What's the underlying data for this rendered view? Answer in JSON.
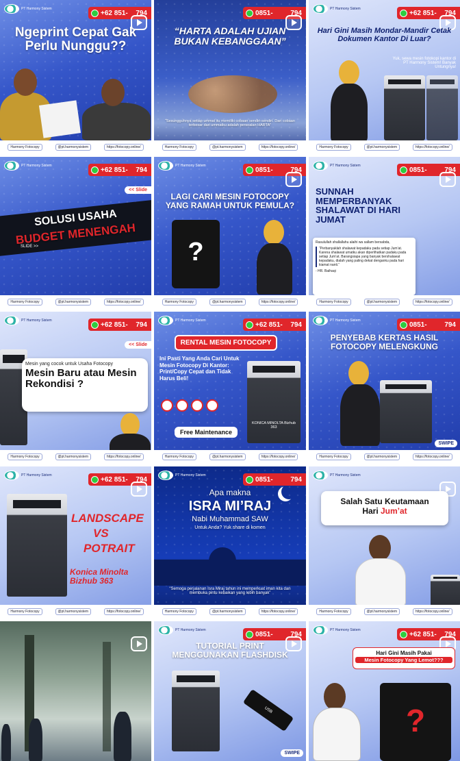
{
  "phone_full": "+62 851-",
  "phone_alt": "0851-",
  "phone_tail": "794",
  "logo_text": "PT Harmony Sistem",
  "footer": {
    "fb": "Harmony Fotocopy",
    "ig": "@pt.harmonysistem",
    "web": "https://fotocopy.online/"
  },
  "tiles": [
    {
      "title": "Ngeprint Cepat Gak Perlu Nunggu??"
    },
    {
      "title": "“HARTA ADALAH UJIAN BUKAN KEBANGGAAN”",
      "quote": "“Sesungguhnya setiap ummat itu memiliki cobaan sendiri-sendiri. Dan cobaan terbesar dari ummatku adalah persoalan HARTA”"
    },
    {
      "title": "Hari Gini Masih Mondar-Mandir Cetak Dokumen Kantor Di Luar?",
      "sub": "Yuk, sewa mesin fotokopi kantor di PT Harmony Sistem! Banyak Untungnya!"
    },
    {
      "title1": "SOLUSI USAHA",
      "title2": "BUDGET MENENGAH",
      "tag": "<< Slide",
      "slide": "SLIDE >>"
    },
    {
      "title": "LAGI CARI MESIN FOTOCOPY YANG RAMAH UNTUK PEMULA?",
      "q": "?"
    },
    {
      "title": "SUNNAH MEMPERBANYAK SHALAWAT DI HARI JUMAT",
      "body1": "Rasulullah shallallahu alaihi wa sallam bersabda,",
      "body2": "“Perbanyaklah shalawat kepadaku pada setiap Jum’at. Karena shalawat umatku akan diperlihatkan padaku pada setiap Jum’at. Barangsiapa yang banyak bershalawat kepadaku, dialah yang paling dekat denganku pada hari kiamat nanti.”",
      "src": "- HR. Baihaqi"
    },
    {
      "small": "Mesin yang cocok untuk Usaha Fotocopy",
      "title": "Mesin Baru atau Mesin Rekondisi ?",
      "tag": "<< Slide"
    },
    {
      "banner": "RENTAL MESIN FOTOCOPY",
      "text": "Ini Pasti Yang Anda Cari Untuk Mesin Fotocopy Di Kantor: Print/Copy Cepat dan Tidak Harus Beli!",
      "cta": "Free Maintenance",
      "brand": "KONICA MINOLTA Bizhub 363"
    },
    {
      "title": "PENYEBAB KERTAS HASIL FOTOCOPY MELENGKUNG",
      "swipe": "SWIPE"
    },
    {
      "t1": "LANDSCAPE",
      "t2": "VS",
      "t3": "POTRAIT",
      "t4": "Konica Minolta Bizhub 363"
    },
    {
      "t1": "Apa makna",
      "t2": "ISRA MI’RAJ",
      "t3": "Nabi Muhammad SAW",
      "t4": "Untuk Anda? Yuk share di komen",
      "quote": "“Semoga perjalanan Isra Miraj tahun ini memperkuat iman kita dan membuka pintu kebaikan yang lebih banyak”"
    },
    {
      "t1": "Salah Satu Keutamaan",
      "t2a": "Hari ",
      "t2b": "Jum’at"
    },
    {},
    {
      "title": "TUTORIAL PRINT MENGGUNAKAN FLASHDISK",
      "usb": "USB",
      "swipe": "SWIPE"
    },
    {
      "t1": "Hari Gini Masih Pakai",
      "t2": "Mesin Fotocopy Yang Lemot???",
      "q": "?"
    }
  ]
}
